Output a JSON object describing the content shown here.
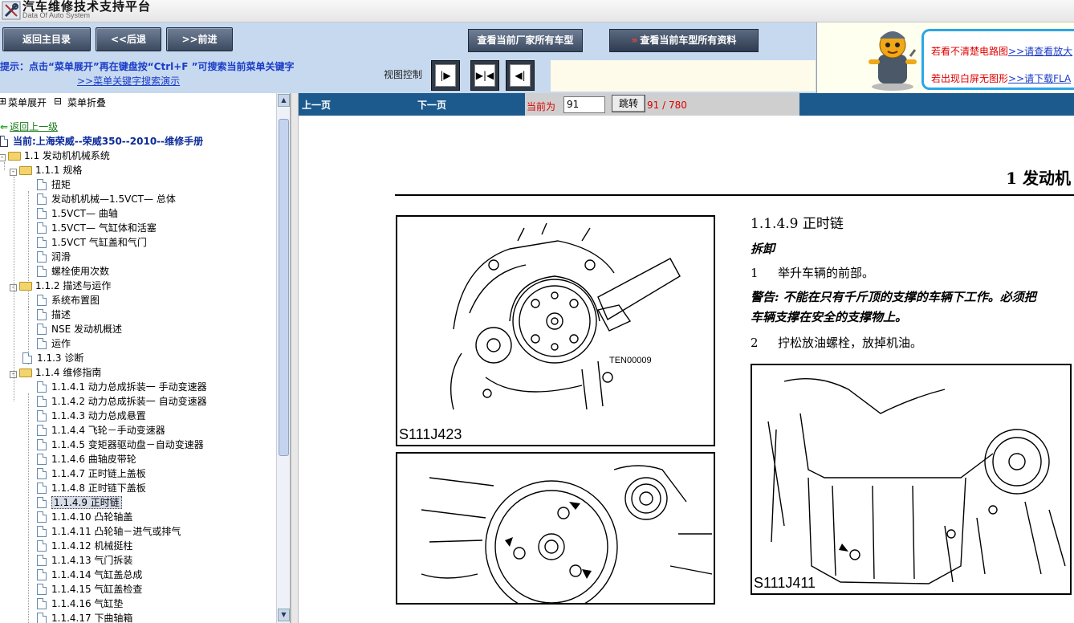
{
  "app": {
    "title": "汽车维修技术支持平台",
    "subtitle": "Data Of Auto System"
  },
  "toolbar": {
    "home_label": "返回主目录",
    "back_label": "<<后退",
    "forward_label": ">>前进",
    "all_models_label": "查看当前厂家所有车型",
    "all_data_label": "查看当前车型所有资料",
    "hint_text": "提示：点击“菜单展开”再在键盘按“Ctrl+F ”可搜索当前菜单关键字",
    "hint_link": ">>菜单关键字搜索演示",
    "view_control_label": "视图控制"
  },
  "notices": {
    "line1_text": "看不清楚电路图",
    "line1_link": ">>请查看放大",
    "line2_text": "出现白屏无图形",
    "line2_link": ">>请下载FLA",
    "prefix": "若"
  },
  "menu": {
    "expand_label": "菜单展开",
    "collapse_label": "菜单折叠"
  },
  "tree": {
    "back_up": "返回上一级",
    "current": "当前:上海荣威--荣威350--2010--维修手册",
    "items": [
      "1.1 发动机机械系统",
      "1.1.1 规格",
      "扭矩",
      "发动机机械—1.5VCT— 总体",
      "1.5VCT— 曲轴",
      "1.5VCT— 气缸体和活塞",
      "1.5VCT 气缸盖和气门",
      "润滑",
      "螺栓使用次数",
      "1.1.2 描述与运作",
      "系统布置图",
      "描述",
      "NSE 发动机概述",
      "运作",
      "1.1.3 诊断",
      "1.1.4 维修指南",
      "1.1.4.1 动力总成拆装一 手动变速器",
      "1.1.4.2 动力总成拆装一 自动变速器",
      "1.1.4.3 动力总成悬置",
      "1.1.4.4 飞轮－手动变速器",
      "1.1.4.5 变矩器驱动盘－自动变速器",
      "1.1.4.6 曲轴皮带轮",
      "1.1.4.7 正时链上盖板",
      "1.1.4.8 正时链下盖板",
      "1.1.4.9 正时链",
      "1.1.4.10 凸轮轴盖",
      "1.1.4.11 凸轮轴－进气或排气",
      "1.1.4.12 机械挺柱",
      "1.1.4.13 气门拆装",
      "1.1.4.14 气缸盖总成",
      "1.1.4.15 气缸盖检查",
      "1.1.4.16 气缸垫",
      "1.1.4.17 下曲轴箱"
    ]
  },
  "pager": {
    "prev_label": "上一页",
    "next_label": "下一页",
    "current_label": "当前为",
    "page_value": "91",
    "go_label": "跳转",
    "count_text": "91 / 780"
  },
  "doc": {
    "chapter_title": "1 发动机",
    "figure1_label": "TEN00009",
    "figure1_caption": "S111J423",
    "figure3_caption": "S111J411",
    "section_title": "1.1.4.9 正时链",
    "sub_heading": "拆卸",
    "step1_num": "1",
    "step1_text": "举升车辆的前部。",
    "warning_line1": "警告: 不能在只有千斤顶的支撑的车辆下工作。必须把",
    "warning_line2": "车辆支撑在安全的支撑物上。",
    "step2_num": "2",
    "step2_text": "拧松放油螺栓，放掉机油。"
  },
  "colors": {
    "toolbar_bg": "#c7d9ef",
    "pagebar_bg": "#1c5a8e",
    "hint_blue": "#1a3cc8",
    "notice_red": "#e00000"
  }
}
